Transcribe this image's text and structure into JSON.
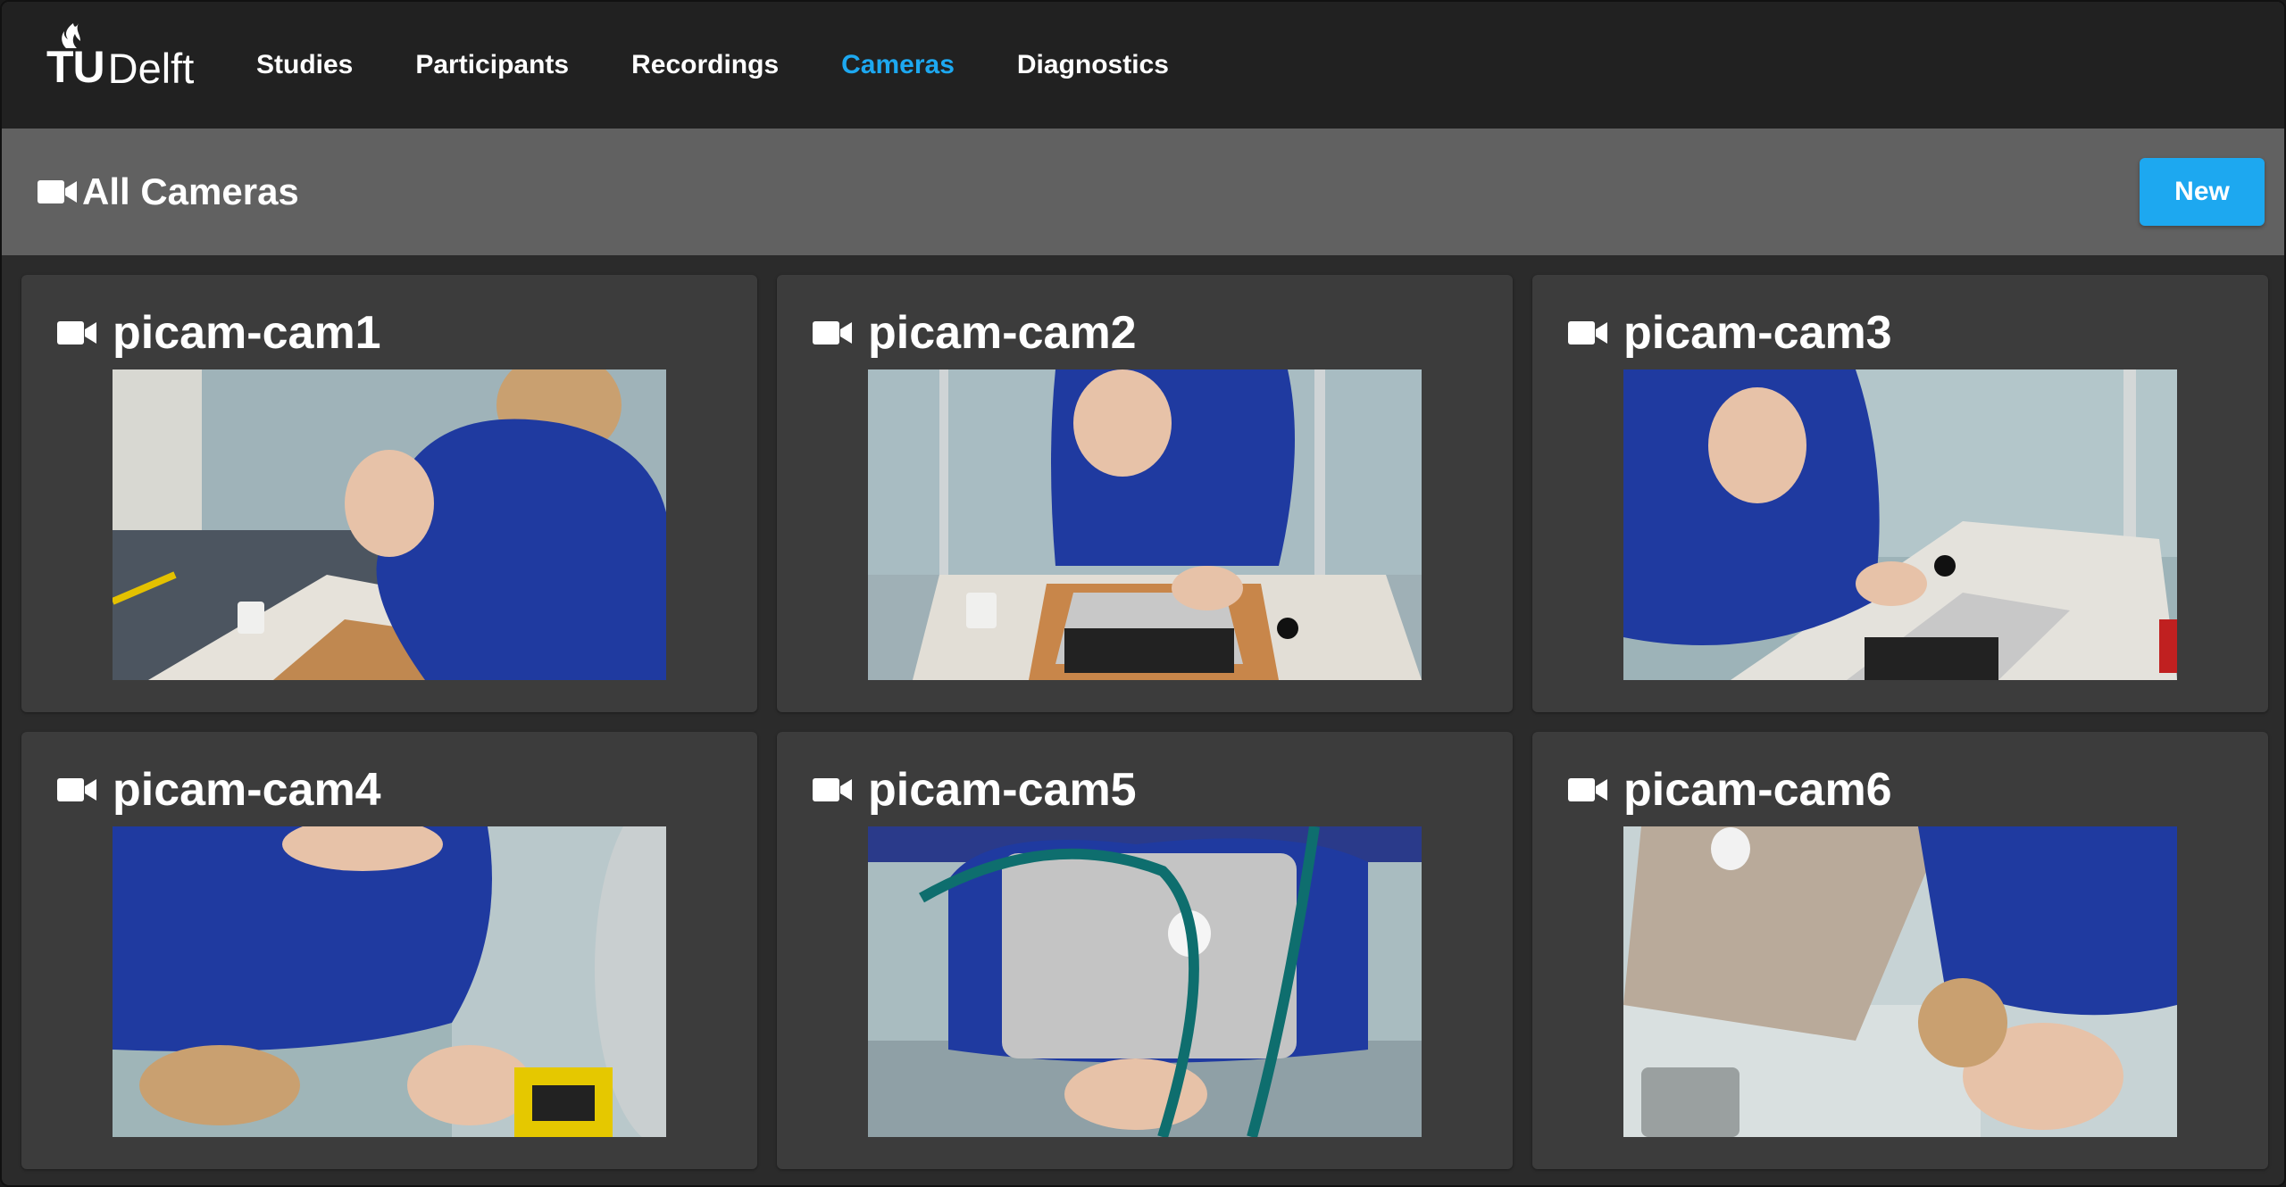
{
  "app": {
    "logo_tu": "TU",
    "logo_delft": "Delft"
  },
  "nav": {
    "items": [
      {
        "label": "Studies",
        "active": false
      },
      {
        "label": "Participants",
        "active": false
      },
      {
        "label": "Recordings",
        "active": false
      },
      {
        "label": "Cameras",
        "active": true
      },
      {
        "label": "Diagnostics",
        "active": false
      }
    ]
  },
  "header": {
    "title": "All Cameras",
    "icon": "video-camera-icon",
    "new_label": "New"
  },
  "cameras": [
    {
      "name": "picam-cam1",
      "icon": "video-camera-icon"
    },
    {
      "name": "picam-cam2",
      "icon": "video-camera-icon"
    },
    {
      "name": "picam-cam3",
      "icon": "video-camera-icon"
    },
    {
      "name": "picam-cam4",
      "icon": "video-camera-icon"
    },
    {
      "name": "picam-cam5",
      "icon": "video-camera-icon"
    },
    {
      "name": "picam-cam6",
      "icon": "video-camera-icon"
    }
  ],
  "colors": {
    "accent": "#1da8f0",
    "navbar_bg": "#212121",
    "header_bg": "#616161",
    "card_bg": "#3c3c3c",
    "page_bg": "#2b2b2b"
  }
}
